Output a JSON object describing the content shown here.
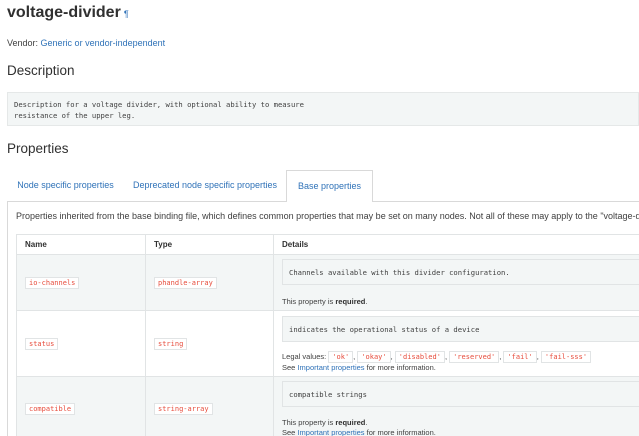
{
  "page": {
    "title": "voltage-divider",
    "pilcrow": "¶",
    "vendor_label": "Vendor:",
    "vendor_value": "Generic or vendor-independent"
  },
  "description": {
    "heading": "Description",
    "text": "Description for a voltage divider, with optional ability to measure\nresistance of the upper leg."
  },
  "properties": {
    "heading": "Properties",
    "tabs": [
      {
        "label": "Node specific properties",
        "active": false
      },
      {
        "label": "Deprecated node specific properties",
        "active": false
      },
      {
        "label": "Base properties",
        "active": true
      }
    ],
    "inherited_note": "Properties inherited from the base binding file, which defines common properties that may be set on many nodes. Not all of these may apply to the \"voltage-divider\"",
    "table": {
      "headers": [
        "Name",
        "Type",
        "Details"
      ],
      "rows": [
        {
          "name": "io-channels",
          "type": "phandle-array",
          "detail_code": "Channels available with this divider configuration.",
          "line1_prefix": "This property is ",
          "line1_bold": "required",
          "line1_suffix": "."
        },
        {
          "name": "status",
          "type": "string",
          "detail_code": "indicates the operational status of a device",
          "legal_label": "Legal values:",
          "legal_values": [
            "'ok'",
            "'okay'",
            "'disabled'",
            "'reserved'",
            "'fail'",
            "'fail-sss'"
          ],
          "see_prefix": "See ",
          "see_link": "Important properties",
          "see_suffix": " for more information."
        },
        {
          "name": "compatible",
          "type": "string-array",
          "detail_code": "compatible strings",
          "line1_prefix": "This property is ",
          "line1_bold": "required",
          "line1_suffix": ".",
          "see_prefix": "See ",
          "see_link": "Important properties",
          "see_suffix": " for more information."
        }
      ]
    }
  },
  "colors": {
    "link": "#2f72b8",
    "literal": "#e74c3c",
    "code_bg": "#f3f6f6"
  }
}
